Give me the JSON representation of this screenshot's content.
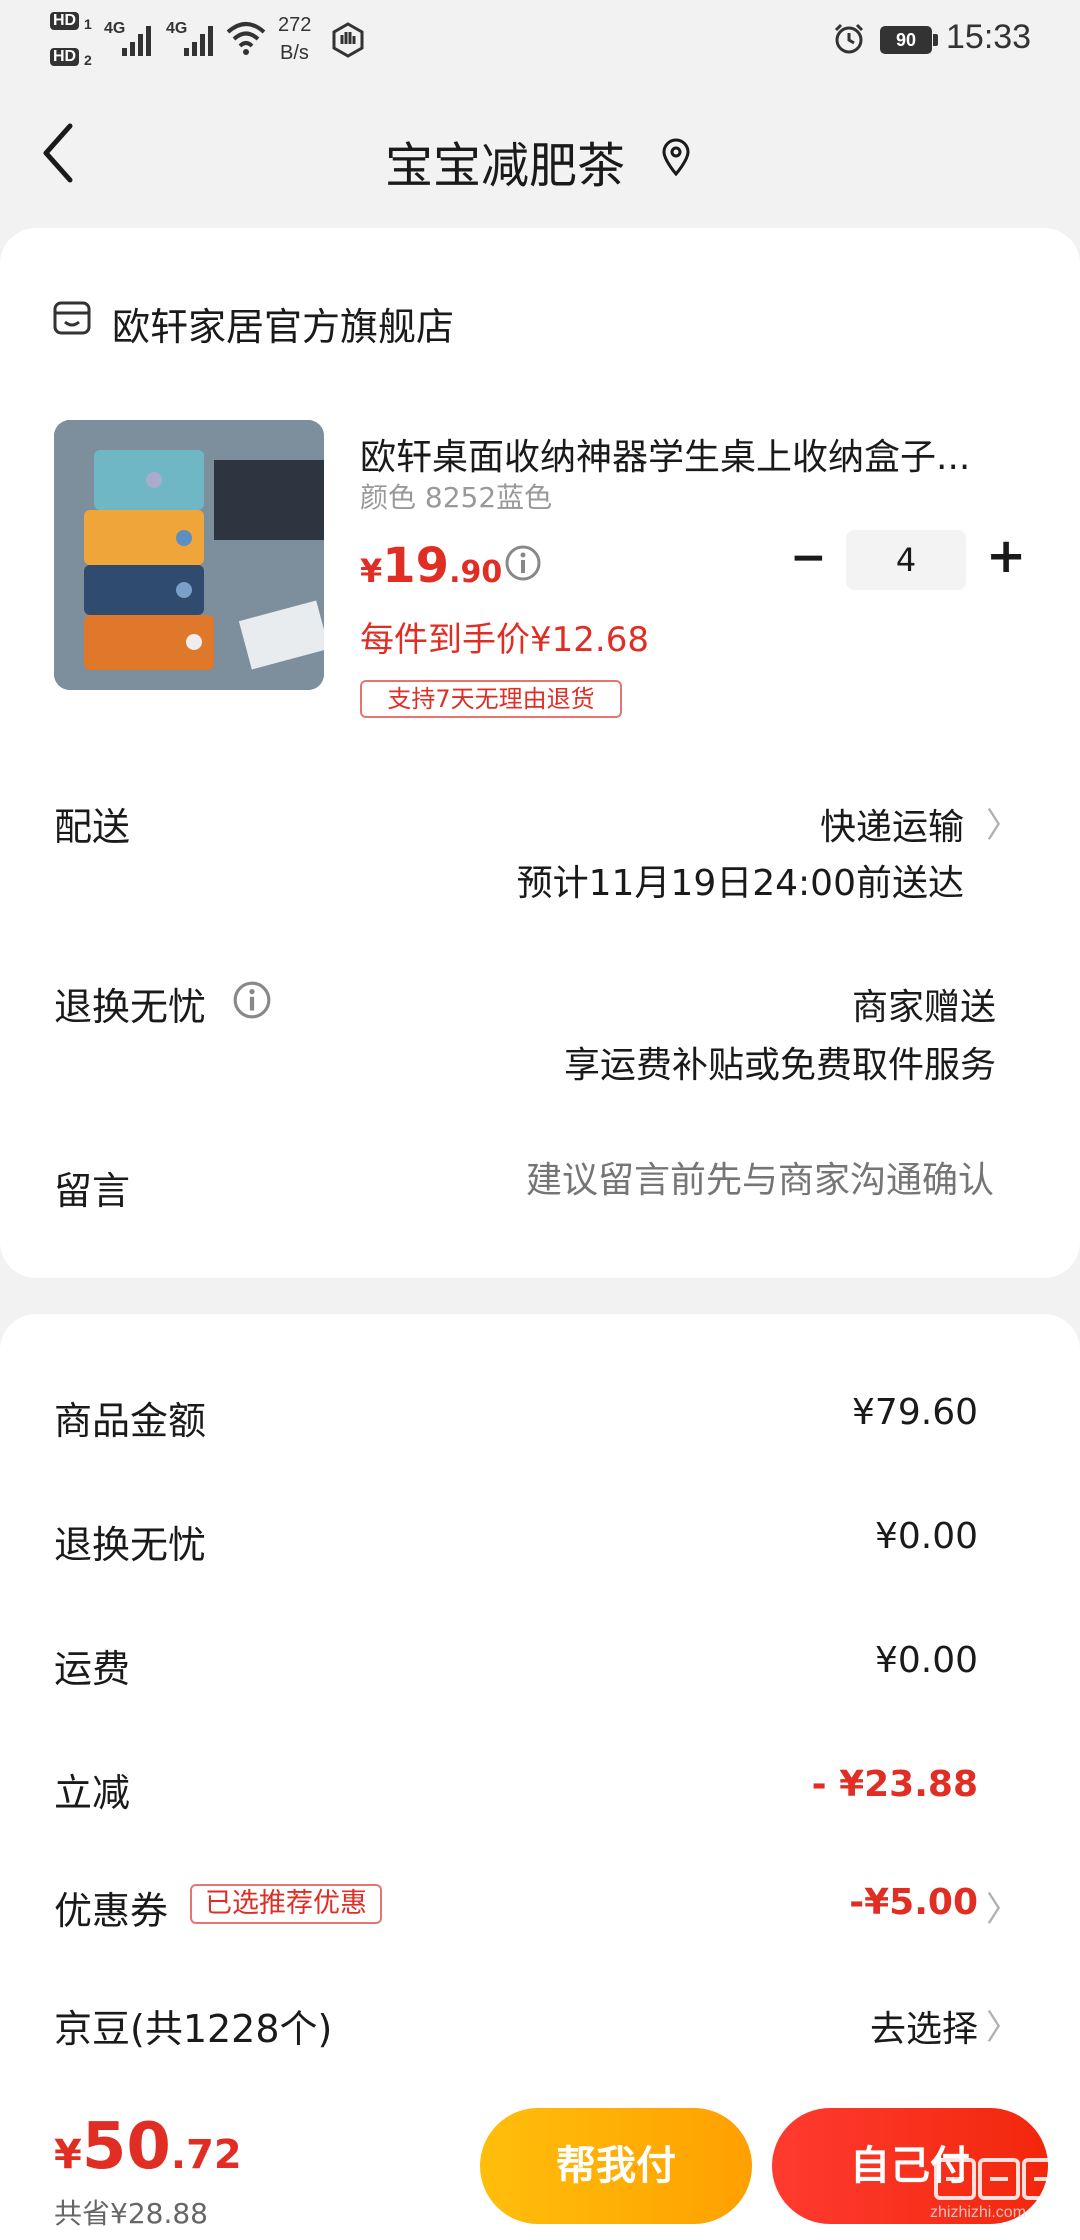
{
  "status_bar": {
    "hd1": "HD",
    "sim1": "1",
    "hd2": "HD",
    "sim2": "2",
    "net1": "4G",
    "net2": "4G",
    "speed_value": "272",
    "speed_unit": "B/s",
    "battery": "90",
    "time": "15:33"
  },
  "header": {
    "title": "宝宝减肥茶"
  },
  "store": {
    "name": "欧轩家居官方旗舰店"
  },
  "product": {
    "name": "欧轩桌面收纳神器学生桌上收纳盒子...",
    "spec": "颜色 8252蓝色",
    "currency": "¥",
    "price_int": "19",
    "price_dec": ".90",
    "unit_price": "每件到手价¥12.68",
    "return_tag": "支持7天无理由退货",
    "quantity": "4",
    "minus": "−",
    "plus": "+"
  },
  "delivery": {
    "label": "配送",
    "method": "快递运输",
    "eta": "预计11月19日24:00前送达"
  },
  "worry_free": {
    "label": "退换无忧",
    "value": "商家赠送",
    "desc": "享运费补贴或免费取件服务"
  },
  "message": {
    "label": "留言",
    "placeholder": "建议留言前先与商家沟通确认"
  },
  "summary": {
    "goods_label": "商品金额",
    "goods_value": "¥79.60",
    "worry_label": "退换无忧",
    "worry_value": "¥0.00",
    "shipping_label": "运费",
    "shipping_value": "¥0.00",
    "discount_label": "立减",
    "discount_value": "- ¥23.88",
    "coupon_label": "优惠券",
    "coupon_tag": "已选推荐优惠",
    "coupon_value": "-¥5.00",
    "jd_label": "京豆(共1228个)",
    "jd_value": "去选择"
  },
  "bottom": {
    "currency": "¥",
    "total_int": "50",
    "total_dec": ".72",
    "saved": "共省¥28.88",
    "help_pay": "帮我付",
    "self_pay": "自己付"
  },
  "watermark": {
    "text": "zhizhizhi.com"
  },
  "colors": {
    "accent_red": "#e02e24",
    "help_pay_start": "#ffbe0b",
    "help_pay_end": "#ffa000",
    "self_pay_start": "#ff3b30",
    "self_pay_end": "#f2270c"
  }
}
